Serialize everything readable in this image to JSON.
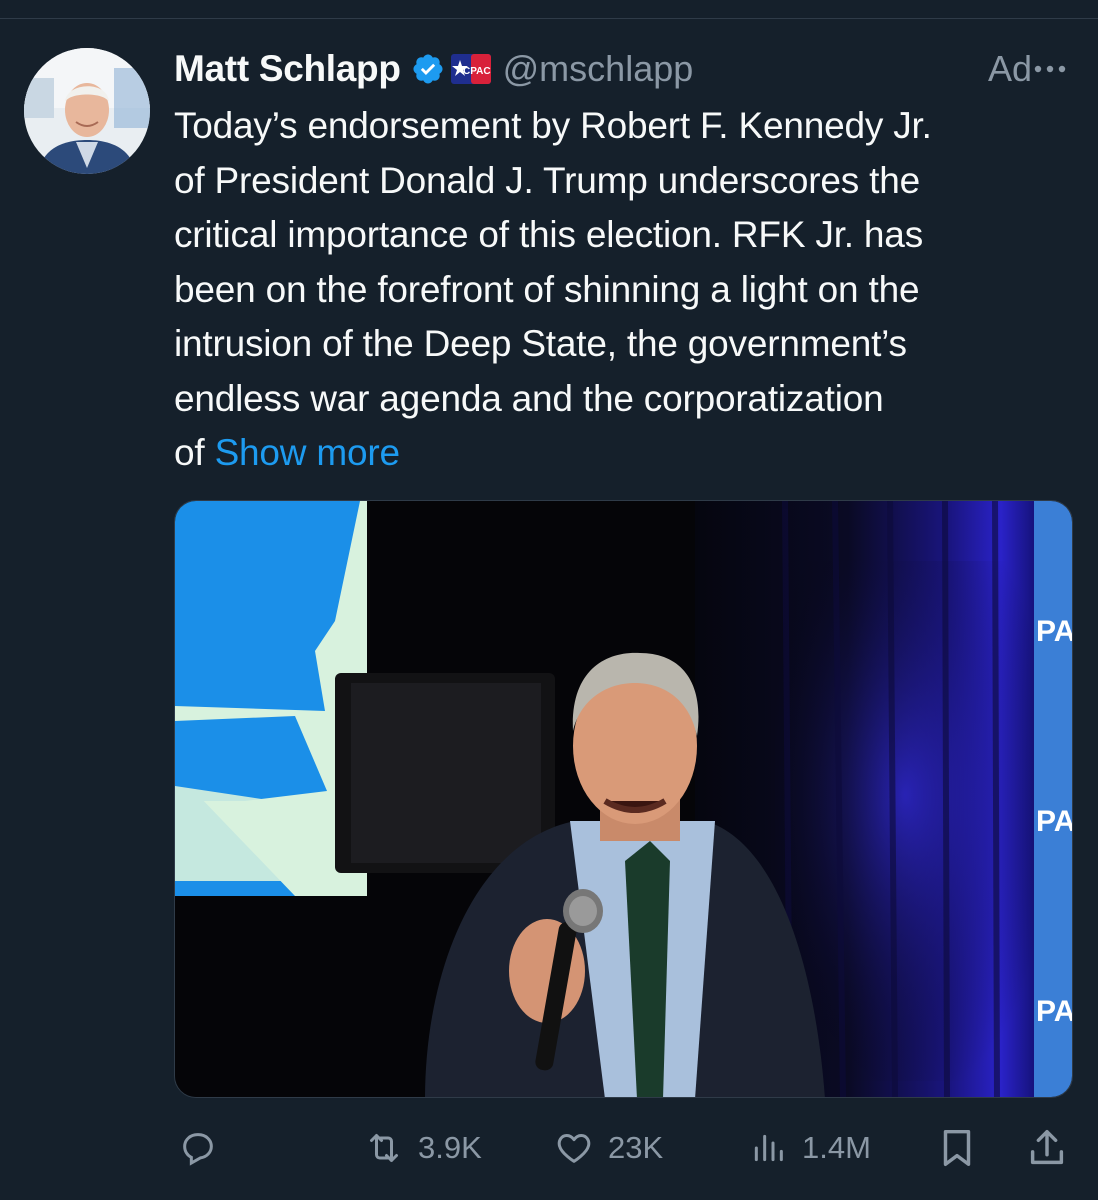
{
  "author": {
    "display_name": "Matt Schlapp",
    "handle": "@mschlapp",
    "verified_icon": "verified-badge-icon",
    "affiliation_badge_text": "CPAC"
  },
  "ad_label": "Ad",
  "tweet": {
    "lines": [
      "Today’s endorsement by Robert F. Kennedy Jr.",
      "of President Donald J. Trump underscores the",
      "critical importance of this election. RFK Jr. has",
      "been on the forefront of shinning a light on the",
      "intrusion of the Deep State, the government’s",
      "endless war agenda and the corporatization"
    ],
    "last_line_prefix": "of",
    "show_more": "Show more"
  },
  "media": {
    "backdrop_text": "PA"
  },
  "actions": {
    "reply_count": "",
    "repost_count": "3.9K",
    "like_count": "23K",
    "views_count": "1.4M"
  },
  "colors": {
    "background": "#15202b",
    "text_primary": "#f7f9f9",
    "text_secondary": "#8b98a5",
    "link": "#1d9bf0",
    "verified": "#1d9bf0"
  }
}
